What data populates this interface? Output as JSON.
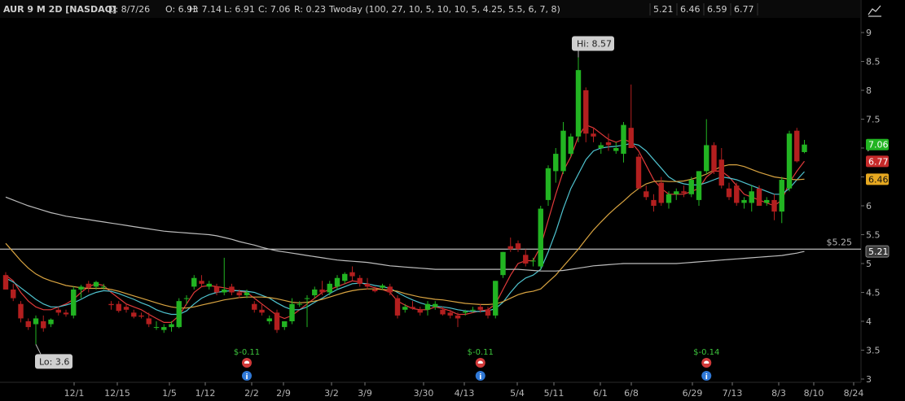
{
  "header": {
    "symbol": "AUR 9 M 2D [NASDAQ]",
    "date": "D: 8/7/26",
    "open": "O: 6.93",
    "high": "H: 7.14",
    "low": "L: 6.91",
    "close": "C: 7.06",
    "range": "R: 0.23",
    "study": "Twoday (100, 27, 10, 5, 10, 10, 5, 4.25, 5.5, 6, 7, 8)",
    "values": [
      {
        "text": "5.21",
        "color": "#d8d8d8"
      },
      {
        "text": "6.46",
        "color": "#e8b84a"
      },
      {
        "text": "6.59",
        "color": "#6fd3df"
      },
      {
        "text": "6.77",
        "color": "#e04040"
      }
    ]
  },
  "colors": {
    "up": "#22b422",
    "down": "#b31f1f",
    "ma_red": "#e03a3a",
    "ma_cyan": "#4fc3cf",
    "ma_orange": "#d9a441",
    "ma_gray": "#bdbdbd",
    "line_white": "#e6e6e6"
  },
  "icons": {
    "toolbar": "chart-style-icon",
    "earnings": "phone-icon",
    "info": "info-icon"
  },
  "chart_data": {
    "type": "candlestick",
    "x_ticks": [
      "12/1",
      "12/15",
      "1/5",
      "1/12",
      "2/2",
      "2/9",
      "3/2",
      "3/9",
      "3/30",
      "4/13",
      "5/4",
      "5/11",
      "6/1",
      "6/8",
      "6/29",
      "7/13",
      "8/3",
      "8/10",
      "8/24"
    ],
    "y_ticks": [
      "3",
      "3.5",
      "4",
      "4.5",
      "5",
      "5.5",
      "6",
      "6.5",
      "7",
      "7.5",
      "8",
      "8.5",
      "9"
    ],
    "ylim": [
      3,
      9.35
    ],
    "candles": [
      {
        "o": 4.8,
        "h": 4.85,
        "l": 4.55,
        "c": 4.55
      },
      {
        "o": 4.55,
        "h": 4.65,
        "l": 4.35,
        "c": 4.4
      },
      {
        "o": 4.3,
        "h": 4.35,
        "l": 3.98,
        "c": 4.05
      },
      {
        "o": 4.0,
        "h": 4.05,
        "l": 3.85,
        "c": 3.9
      },
      {
        "o": 3.95,
        "h": 4.1,
        "l": 3.6,
        "c": 4.05
      },
      {
        "o": 4.0,
        "h": 4.1,
        "l": 3.82,
        "c": 3.88
      },
      {
        "o": 3.95,
        "h": 4.05,
        "l": 3.9,
        "c": 4.03
      },
      {
        "o": 4.2,
        "h": 4.25,
        "l": 4.1,
        "c": 4.15
      },
      {
        "o": 4.15,
        "h": 4.2,
        "l": 4.08,
        "c": 4.12
      },
      {
        "o": 4.1,
        "h": 4.6,
        "l": 4.05,
        "c": 4.55
      },
      {
        "o": 4.55,
        "h": 4.63,
        "l": 4.4,
        "c": 4.6
      },
      {
        "o": 4.65,
        "h": 4.7,
        "l": 4.5,
        "c": 4.58
      },
      {
        "o": 4.6,
        "h": 4.7,
        "l": 4.55,
        "c": 4.68
      },
      {
        "o": 4.6,
        "h": 4.65,
        "l": 4.55,
        "c": 4.6
      },
      {
        "o": 4.3,
        "h": 4.35,
        "l": 4.2,
        "c": 4.28
      },
      {
        "o": 4.3,
        "h": 4.35,
        "l": 4.15,
        "c": 4.18
      },
      {
        "o": 4.25,
        "h": 4.3,
        "l": 4.15,
        "c": 4.2
      },
      {
        "o": 4.15,
        "h": 4.2,
        "l": 4.05,
        "c": 4.08
      },
      {
        "o": 4.1,
        "h": 4.15,
        "l": 4.05,
        "c": 4.08
      },
      {
        "o": 4.05,
        "h": 4.15,
        "l": 3.9,
        "c": 3.95
      },
      {
        "o": 3.9,
        "h": 4.0,
        "l": 3.85,
        "c": 3.9
      },
      {
        "o": 3.85,
        "h": 3.95,
        "l": 3.8,
        "c": 3.9
      },
      {
        "o": 3.9,
        "h": 4.0,
        "l": 3.82,
        "c": 3.95
      },
      {
        "o": 3.9,
        "h": 4.4,
        "l": 3.88,
        "c": 4.35
      },
      {
        "o": 4.4,
        "h": 4.45,
        "l": 4.3,
        "c": 4.4
      },
      {
        "o": 4.6,
        "h": 4.8,
        "l": 4.55,
        "c": 4.75
      },
      {
        "o": 4.7,
        "h": 4.8,
        "l": 4.6,
        "c": 4.65
      },
      {
        "o": 4.6,
        "h": 4.7,
        "l": 4.55,
        "c": 4.65
      },
      {
        "o": 4.6,
        "h": 4.65,
        "l": 4.45,
        "c": 4.5
      },
      {
        "o": 4.5,
        "h": 5.1,
        "l": 4.45,
        "c": 4.55
      },
      {
        "o": 4.6,
        "h": 4.65,
        "l": 4.45,
        "c": 4.5
      },
      {
        "o": 4.5,
        "h": 4.55,
        "l": 4.4,
        "c": 4.45
      },
      {
        "o": 4.45,
        "h": 4.55,
        "l": 4.4,
        "c": 4.5
      },
      {
        "o": 4.3,
        "h": 4.35,
        "l": 4.15,
        "c": 4.2
      },
      {
        "o": 4.2,
        "h": 4.3,
        "l": 4.1,
        "c": 4.15
      },
      {
        "o": 4.0,
        "h": 4.1,
        "l": 3.95,
        "c": 4.05
      },
      {
        "o": 4.15,
        "h": 4.2,
        "l": 3.8,
        "c": 3.85
      },
      {
        "o": 3.9,
        "h": 4.0,
        "l": 3.85,
        "c": 4.0
      },
      {
        "o": 4.0,
        "h": 4.4,
        "l": 3.95,
        "c": 4.3
      },
      {
        "o": 4.3,
        "h": 4.35,
        "l": 4.25,
        "c": 4.3
      },
      {
        "o": 4.4,
        "h": 4.45,
        "l": 3.9,
        "c": 4.4
      },
      {
        "o": 4.45,
        "h": 4.6,
        "l": 4.4,
        "c": 4.55
      },
      {
        "o": 4.55,
        "h": 4.7,
        "l": 4.45,
        "c": 4.5
      },
      {
        "o": 4.5,
        "h": 4.7,
        "l": 4.45,
        "c": 4.65
      },
      {
        "o": 4.6,
        "h": 4.8,
        "l": 4.55,
        "c": 4.75
      },
      {
        "o": 4.7,
        "h": 4.85,
        "l": 4.65,
        "c": 4.82
      },
      {
        "o": 4.85,
        "h": 4.95,
        "l": 4.7,
        "c": 4.78
      },
      {
        "o": 4.75,
        "h": 4.8,
        "l": 4.6,
        "c": 4.65
      },
      {
        "o": 4.65,
        "h": 4.75,
        "l": 4.55,
        "c": 4.6
      },
      {
        "o": 4.55,
        "h": 4.6,
        "l": 4.5,
        "c": 4.52
      },
      {
        "o": 4.58,
        "h": 4.65,
        "l": 4.55,
        "c": 4.62
      },
      {
        "o": 4.6,
        "h": 4.65,
        "l": 4.45,
        "c": 4.5
      },
      {
        "o": 4.4,
        "h": 4.45,
        "l": 4.05,
        "c": 4.1
      },
      {
        "o": 4.2,
        "h": 4.3,
        "l": 4.15,
        "c": 4.25
      },
      {
        "o": 4.25,
        "h": 4.35,
        "l": 4.2,
        "c": 4.22
      },
      {
        "o": 4.2,
        "h": 4.25,
        "l": 4.1,
        "c": 4.15
      },
      {
        "o": 4.2,
        "h": 4.35,
        "l": 4.1,
        "c": 4.3
      },
      {
        "o": 4.25,
        "h": 4.35,
        "l": 4.2,
        "c": 4.3
      },
      {
        "o": 4.2,
        "h": 4.25,
        "l": 4.1,
        "c": 4.12
      },
      {
        "o": 4.15,
        "h": 4.2,
        "l": 4.05,
        "c": 4.1
      },
      {
        "o": 4.1,
        "h": 4.15,
        "l": 3.9,
        "c": 4.05
      },
      {
        "o": 4.15,
        "h": 4.2,
        "l": 4.1,
        "c": 4.17
      },
      {
        "o": 4.2,
        "h": 4.25,
        "l": 4.15,
        "c": 4.2
      },
      {
        "o": 4.25,
        "h": 4.3,
        "l": 4.15,
        "c": 4.2
      },
      {
        "o": 4.2,
        "h": 4.25,
        "l": 4.05,
        "c": 4.1
      },
      {
        "o": 4.1,
        "h": 4.7,
        "l": 4.05,
        "c": 4.7
      },
      {
        "o": 4.8,
        "h": 5.2,
        "l": 4.75,
        "c": 5.2
      },
      {
        "o": 5.3,
        "h": 5.45,
        "l": 5.2,
        "c": 5.25
      },
      {
        "o": 5.35,
        "h": 5.4,
        "l": 5.2,
        "c": 5.25
      },
      {
        "o": 5.15,
        "h": 5.25,
        "l": 4.95,
        "c": 5.0
      },
      {
        "o": 5.05,
        "h": 5.1,
        "l": 4.95,
        "c": 5.05
      },
      {
        "o": 4.95,
        "h": 6.0,
        "l": 4.9,
        "c": 5.95
      },
      {
        "o": 6.1,
        "h": 6.7,
        "l": 6.0,
        "c": 6.65
      },
      {
        "o": 6.6,
        "h": 7.0,
        "l": 6.4,
        "c": 6.9
      },
      {
        "o": 6.6,
        "h": 7.45,
        "l": 6.55,
        "c": 7.3
      },
      {
        "o": 6.9,
        "h": 7.25,
        "l": 6.85,
        "c": 7.2
      },
      {
        "o": 7.2,
        "h": 8.57,
        "l": 7.1,
        "c": 8.35
      },
      {
        "o": 8.0,
        "h": 8.05,
        "l": 7.1,
        "c": 7.25
      },
      {
        "o": 7.25,
        "h": 7.35,
        "l": 7.1,
        "c": 7.2
      },
      {
        "o": 7.0,
        "h": 7.1,
        "l": 6.9,
        "c": 7.05
      },
      {
        "o": 7.1,
        "h": 7.25,
        "l": 6.95,
        "c": 7.05
      },
      {
        "o": 6.95,
        "h": 7.1,
        "l": 6.9,
        "c": 7.0
      },
      {
        "o": 6.9,
        "h": 7.45,
        "l": 6.75,
        "c": 7.4
      },
      {
        "o": 7.35,
        "h": 8.1,
        "l": 7.0,
        "c": 7.0
      },
      {
        "o": 6.85,
        "h": 6.9,
        "l": 6.3,
        "c": 6.3
      },
      {
        "o": 6.25,
        "h": 6.35,
        "l": 6.1,
        "c": 6.15
      },
      {
        "o": 6.1,
        "h": 6.2,
        "l": 5.9,
        "c": 6.0
      },
      {
        "o": 6.4,
        "h": 6.5,
        "l": 6.0,
        "c": 6.05
      },
      {
        "o": 6.05,
        "h": 6.25,
        "l": 5.95,
        "c": 6.2
      },
      {
        "o": 6.2,
        "h": 6.3,
        "l": 6.1,
        "c": 6.25
      },
      {
        "o": 6.25,
        "h": 6.35,
        "l": 6.15,
        "c": 6.22
      },
      {
        "o": 6.2,
        "h": 6.5,
        "l": 6.15,
        "c": 6.45
      },
      {
        "o": 6.1,
        "h": 6.6,
        "l": 6.0,
        "c": 6.6
      },
      {
        "o": 6.6,
        "h": 7.5,
        "l": 6.55,
        "c": 7.05
      },
      {
        "o": 7.05,
        "h": 7.1,
        "l": 6.55,
        "c": 6.6
      },
      {
        "o": 6.8,
        "h": 7.0,
        "l": 6.3,
        "c": 6.35
      },
      {
        "o": 6.3,
        "h": 6.4,
        "l": 6.1,
        "c": 6.15
      },
      {
        "o": 6.35,
        "h": 6.4,
        "l": 6.0,
        "c": 6.05
      },
      {
        "o": 6.05,
        "h": 6.15,
        "l": 5.95,
        "c": 6.1
      },
      {
        "o": 6.05,
        "h": 6.35,
        "l": 5.9,
        "c": 6.25
      },
      {
        "o": 6.3,
        "h": 6.35,
        "l": 6.0,
        "c": 6.0
      },
      {
        "o": 6.05,
        "h": 6.15,
        "l": 6.0,
        "c": 6.1
      },
      {
        "o": 6.1,
        "h": 6.2,
        "l": 5.75,
        "c": 5.9
      },
      {
        "o": 5.9,
        "h": 6.5,
        "l": 5.7,
        "c": 6.45
      },
      {
        "o": 6.3,
        "h": 7.3,
        "l": 6.25,
        "c": 7.25
      },
      {
        "o": 7.3,
        "h": 7.35,
        "l": 6.75,
        "c": 6.77
      },
      {
        "o": 6.93,
        "h": 7.14,
        "l": 6.91,
        "c": 7.06
      }
    ],
    "series": [
      {
        "color_key": "ma_red",
        "values": [
          4.8,
          4.7,
          4.5,
          4.35,
          4.25,
          4.2,
          4.2,
          4.25,
          4.3,
          4.38,
          4.5,
          4.6,
          4.65,
          4.62,
          4.5,
          4.4,
          4.3,
          4.25,
          4.2,
          4.12,
          4.05,
          3.98,
          3.98,
          4.1,
          4.3,
          4.5,
          4.6,
          4.62,
          4.6,
          4.58,
          4.55,
          4.52,
          4.5,
          4.4,
          4.3,
          4.2,
          4.1,
          4.05,
          4.1,
          4.2,
          4.3,
          4.4,
          4.5,
          4.55,
          4.6,
          4.65,
          4.7,
          4.68,
          4.62,
          4.58,
          4.55,
          4.5,
          4.35,
          4.28,
          4.22,
          4.2,
          4.2,
          4.25,
          4.22,
          4.18,
          4.12,
          4.12,
          4.15,
          4.18,
          4.2,
          4.3,
          4.55,
          4.8,
          5.0,
          5.05,
          5.05,
          5.3,
          5.75,
          6.2,
          6.6,
          6.85,
          7.2,
          7.4,
          7.35,
          7.25,
          7.15,
          7.1,
          7.15,
          7.1,
          6.95,
          6.7,
          6.45,
          6.3,
          6.2,
          6.2,
          6.2,
          6.25,
          6.3,
          6.5,
          6.6,
          6.6,
          6.5,
          6.35,
          6.2,
          6.15,
          6.1,
          6.05,
          6.0,
          6.1,
          6.4,
          6.6,
          6.77
        ]
      },
      {
        "color_key": "ma_cyan",
        "values": [
          4.75,
          4.68,
          4.58,
          4.48,
          4.38,
          4.3,
          4.25,
          4.25,
          4.28,
          4.32,
          4.38,
          4.45,
          4.5,
          4.53,
          4.52,
          4.48,
          4.43,
          4.38,
          4.32,
          4.27,
          4.2,
          4.15,
          4.12,
          4.12,
          4.18,
          4.3,
          4.4,
          4.46,
          4.5,
          4.52,
          4.53,
          4.53,
          4.52,
          4.5,
          4.45,
          4.4,
          4.32,
          4.25,
          4.2,
          4.2,
          4.25,
          4.33,
          4.4,
          4.48,
          4.55,
          4.6,
          4.65,
          4.66,
          4.65,
          4.62,
          4.6,
          4.57,
          4.5,
          4.43,
          4.37,
          4.32,
          4.28,
          4.26,
          4.25,
          4.23,
          4.2,
          4.18,
          4.17,
          4.17,
          4.18,
          4.22,
          4.33,
          4.5,
          4.65,
          4.75,
          4.8,
          4.9,
          5.2,
          5.55,
          5.95,
          6.3,
          6.55,
          6.8,
          6.95,
          7.0,
          7.02,
          7.03,
          7.05,
          7.08,
          7.05,
          6.95,
          6.8,
          6.65,
          6.5,
          6.42,
          6.38,
          6.36,
          6.36,
          6.4,
          6.45,
          6.5,
          6.48,
          6.45,
          6.4,
          6.35,
          6.3,
          6.25,
          6.2,
          6.2,
          6.3,
          6.45,
          6.59
        ]
      },
      {
        "color_key": "ma_orange",
        "values": [
          5.35,
          5.2,
          5.05,
          4.92,
          4.82,
          4.75,
          4.7,
          4.66,
          4.62,
          4.6,
          4.58,
          4.57,
          4.57,
          4.57,
          4.55,
          4.52,
          4.48,
          4.44,
          4.4,
          4.36,
          4.32,
          4.28,
          4.25,
          4.23,
          4.23,
          4.25,
          4.28,
          4.31,
          4.34,
          4.37,
          4.39,
          4.41,
          4.42,
          4.42,
          4.42,
          4.41,
          4.39,
          4.36,
          4.33,
          4.32,
          4.33,
          4.35,
          4.38,
          4.42,
          4.46,
          4.5,
          4.53,
          4.55,
          4.56,
          4.56,
          4.55,
          4.54,
          4.52,
          4.48,
          4.45,
          4.42,
          4.4,
          4.38,
          4.37,
          4.35,
          4.33,
          4.31,
          4.3,
          4.29,
          4.29,
          4.3,
          4.34,
          4.4,
          4.46,
          4.5,
          4.52,
          4.56,
          4.68,
          4.8,
          4.95,
          5.1,
          5.25,
          5.42,
          5.58,
          5.72,
          5.85,
          5.97,
          6.08,
          6.2,
          6.3,
          6.38,
          6.42,
          6.43,
          6.42,
          6.42,
          6.43,
          6.46,
          6.5,
          6.55,
          6.62,
          6.68,
          6.71,
          6.71,
          6.68,
          6.63,
          6.58,
          6.54,
          6.5,
          6.48,
          6.46,
          6.45,
          6.46
        ]
      },
      {
        "color_key": "ma_gray",
        "values": [
          6.15,
          6.1,
          6.05,
          6.0,
          5.96,
          5.92,
          5.88,
          5.85,
          5.82,
          5.8,
          5.78,
          5.76,
          5.74,
          5.72,
          5.7,
          5.68,
          5.66,
          5.64,
          5.62,
          5.6,
          5.58,
          5.56,
          5.55,
          5.54,
          5.53,
          5.52,
          5.51,
          5.5,
          5.48,
          5.45,
          5.42,
          5.38,
          5.35,
          5.32,
          5.28,
          5.25,
          5.22,
          5.2,
          5.18,
          5.16,
          5.14,
          5.12,
          5.1,
          5.08,
          5.06,
          5.05,
          5.04,
          5.03,
          5.02,
          5.0,
          4.98,
          4.96,
          4.95,
          4.94,
          4.93,
          4.92,
          4.91,
          4.9,
          4.9,
          4.9,
          4.9,
          4.9,
          4.9,
          4.9,
          4.9,
          4.9,
          4.9,
          4.9,
          4.9,
          4.89,
          4.88,
          4.87,
          4.87,
          4.87,
          4.88,
          4.9,
          4.92,
          4.94,
          4.96,
          4.97,
          4.98,
          4.99,
          5.0,
          5.0,
          5.0,
          5.0,
          5.0,
          5.0,
          5.0,
          5.0,
          5.01,
          5.02,
          5.03,
          5.04,
          5.05,
          5.06,
          5.07,
          5.08,
          5.09,
          5.1,
          5.11,
          5.12,
          5.13,
          5.14,
          5.16,
          5.18,
          5.21
        ]
      }
    ],
    "horizontal_line": {
      "value": 5.25,
      "label": "$5.25"
    },
    "annotations": {
      "high": {
        "index": 76,
        "text": "Hi: 8.57"
      },
      "low": {
        "index": 4,
        "text": "Lo: 3.6"
      }
    },
    "price_tags": [
      {
        "value": 7.06,
        "text": "7.06",
        "color": "#22b422"
      },
      {
        "value": 6.77,
        "text": "6.77",
        "color": "#c62a2a"
      },
      {
        "value": 6.46,
        "text": "6.46",
        "color": "#e6a820"
      },
      {
        "value": 5.21,
        "text": "5.21",
        "color": "#3a3a3a"
      }
    ],
    "events": [
      {
        "index": 32,
        "text": "$-0.11"
      },
      {
        "index": 63,
        "text": "$-0.11"
      },
      {
        "index": 93,
        "text": "$-0.14"
      }
    ]
  }
}
